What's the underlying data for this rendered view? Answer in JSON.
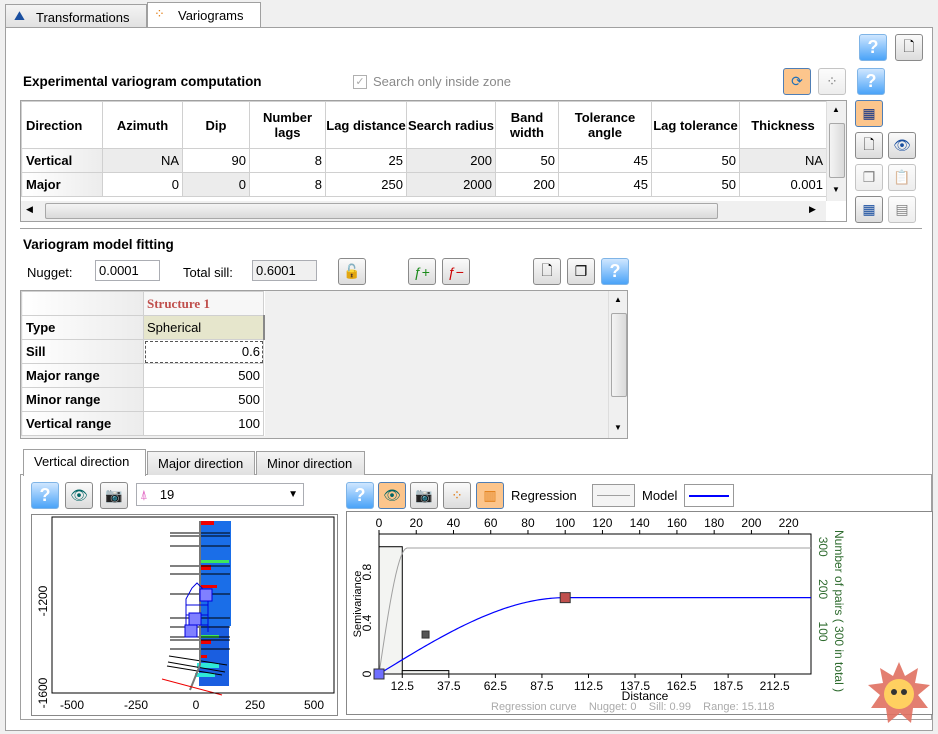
{
  "tabs": [
    {
      "label": "Transformations",
      "icon": "transformations-icon"
    },
    {
      "label": "Variograms",
      "icon": "variograms-icon",
      "active": true
    }
  ],
  "experimental": {
    "title": "Experimental variogram computation",
    "search_inside_zone": {
      "label": "Search only inside zone",
      "checked": true,
      "enabled": false
    },
    "columns": [
      "Direction",
      "Azimuth",
      "Dip",
      "Number lags",
      "Lag distance",
      "Search radius",
      "Band width",
      "Tolerance angle",
      "Lag tolerance",
      "Thickness"
    ],
    "rows": [
      [
        "Vertical",
        "NA",
        "90",
        "8",
        "25",
        "200",
        "50",
        "45",
        "50",
        "NA"
      ],
      [
        "Major",
        "0",
        "0",
        "8",
        "250",
        "2000",
        "200",
        "45",
        "50",
        "0.001"
      ]
    ]
  },
  "model": {
    "title": "Variogram model fitting",
    "nugget_label": "Nugget:",
    "nugget": "0.0001",
    "total_sill_label": "Total sill:",
    "total_sill": "0.6001",
    "structure_header": "Structure 1",
    "rows": [
      {
        "label": "Type",
        "value": "Spherical"
      },
      {
        "label": "Sill",
        "value": "0.6"
      },
      {
        "label": "Major range",
        "value": "500"
      },
      {
        "label": "Minor range",
        "value": "500"
      },
      {
        "label": "Vertical range",
        "value": "100"
      }
    ]
  },
  "direction_tabs": [
    {
      "label": "Vertical direction",
      "active": true
    },
    {
      "label": "Major direction"
    },
    {
      "label": "Minor direction"
    }
  ],
  "well_selector": {
    "value": "19",
    "icon": "well-icon"
  },
  "legend": {
    "regression": "Regression",
    "model": "Model",
    "regression_color": "#a0a0a0",
    "model_color": "#0000ff"
  },
  "well_plot": {
    "x_ticks": [
      "-500",
      "-250",
      "0",
      "250",
      "500"
    ],
    "y_ticks": [
      "-1200",
      "-1600"
    ]
  },
  "chart_data": {
    "type": "line",
    "xlabel": "Distance",
    "ylabel": "Semivariance",
    "y2label": "Number of pairs ( 300 in total )",
    "top_ticks": [
      0,
      20,
      40,
      60,
      80,
      100,
      120,
      140,
      160,
      180,
      200,
      220
    ],
    "bottom_ticks": [
      12.5,
      37.5,
      62.5,
      87.5,
      112.5,
      137.5,
      162.5,
      187.5,
      212.5
    ],
    "y_ticks": [
      0,
      0.4,
      0.8
    ],
    "y2_ticks": [
      100,
      200,
      300
    ],
    "xlim": [
      0,
      232
    ],
    "ylim": [
      0,
      1.1
    ],
    "y2lim": [
      0,
      330
    ],
    "pairs_histogram": [
      {
        "from": 0,
        "to": 12.5,
        "count": 300
      },
      {
        "from": 12.5,
        "to": 37.5,
        "count": 8
      }
    ],
    "experimental_points": [
      {
        "x": 0,
        "y": 0,
        "color": "#6f6fff"
      },
      {
        "x": 25,
        "y": 0.31,
        "color": "#555555"
      },
      {
        "x": 100,
        "y": 0.6,
        "color": "#c0504d"
      }
    ],
    "model": {
      "type": "spherical",
      "nugget": 0.0001,
      "sill": 0.6,
      "range": 100
    },
    "regression": {
      "nugget": 0,
      "sill": 0.99,
      "range": 15.118
    },
    "footer": "Regression curve    Nugget: 0    Sill: 0.99    Range: 15.118"
  }
}
